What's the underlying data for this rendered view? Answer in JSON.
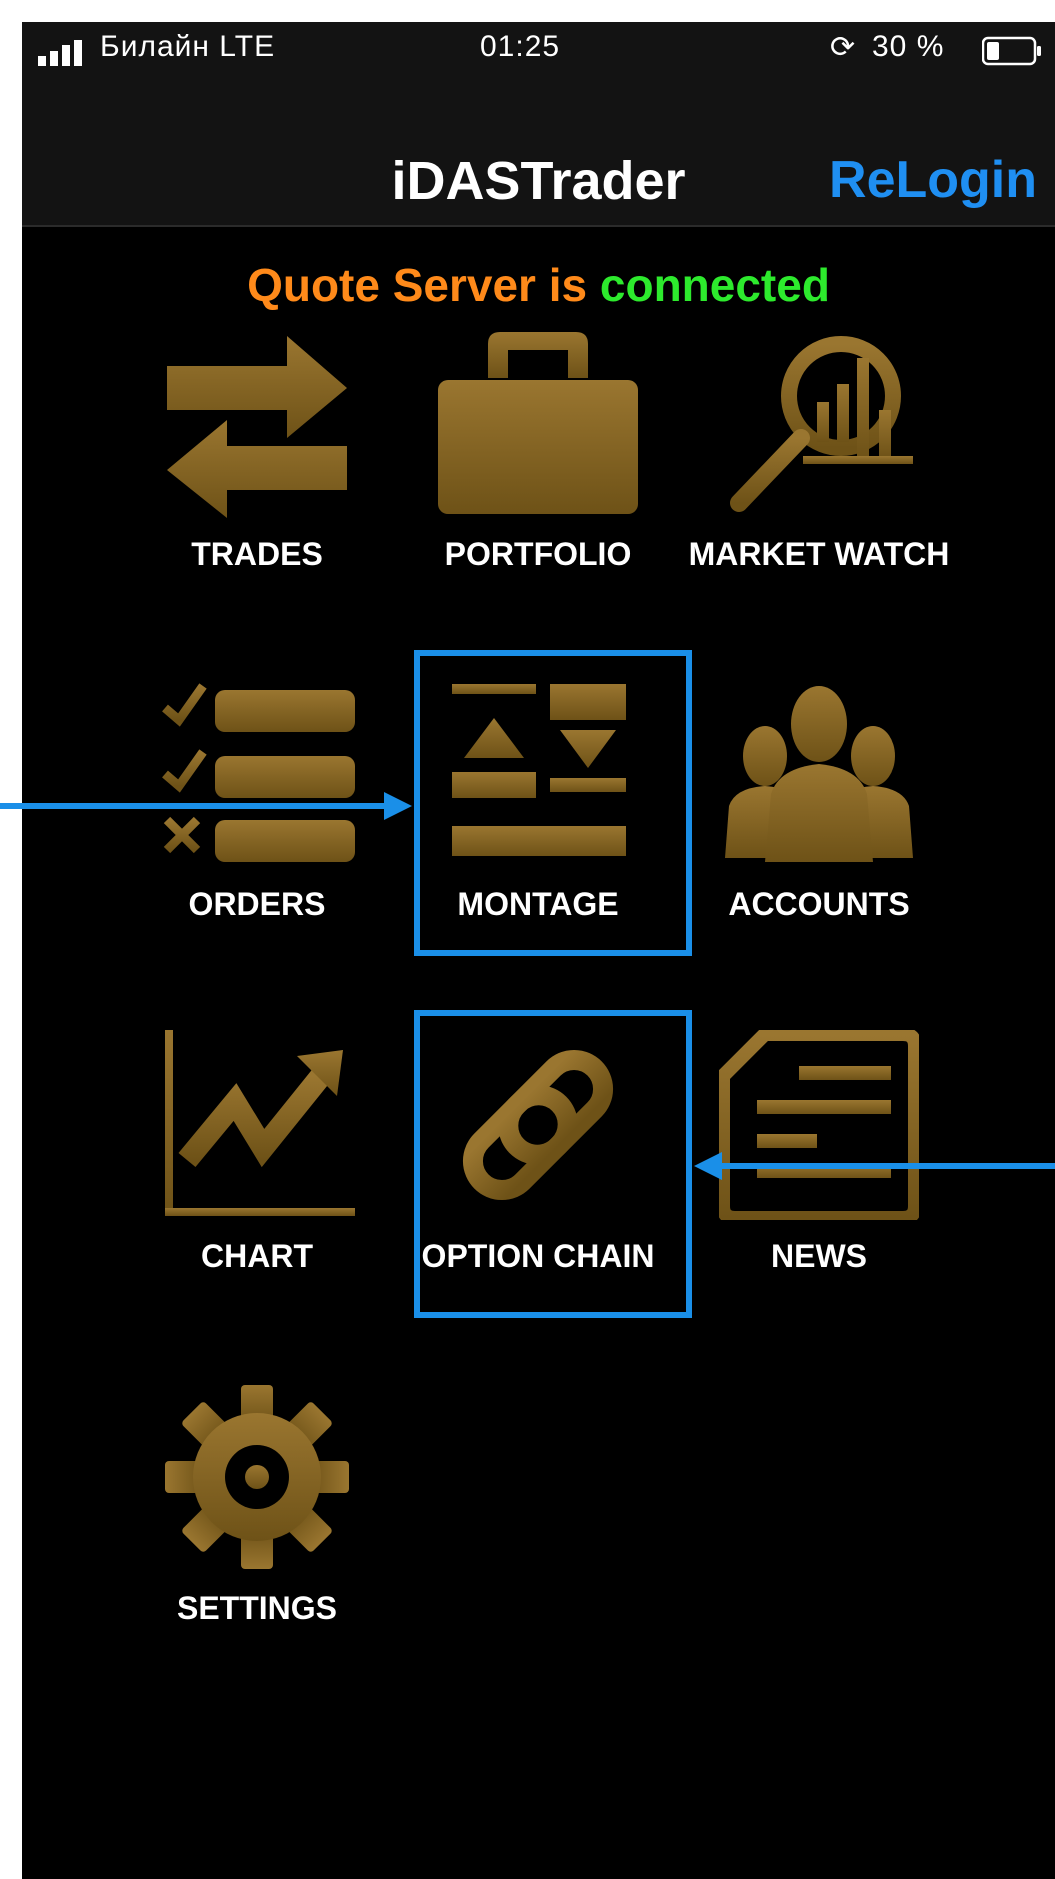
{
  "status_bar": {
    "carrier": "Билайн LTE",
    "time": "01:25",
    "battery": "30 %"
  },
  "nav": {
    "title": "iDASTrader",
    "relogin_label": "ReLogin"
  },
  "connection": {
    "prefix": "Quote Server is",
    "state": "connected"
  },
  "menu": {
    "trades": "TRADES",
    "portfolio": "PORTFOLIO",
    "market_watch": "MARKET WATCH",
    "orders": "ORDERS",
    "montage": "MONTAGE",
    "accounts": "ACCOUNTS",
    "chart": "CHART",
    "option_chain": "OPTION CHAIN",
    "news": "NEWS",
    "settings": "SETTINGS"
  },
  "colors": {
    "icon_gold": "#8b6a22",
    "highlight_blue": "#1a8fe8",
    "link_blue": "#1f8ff2",
    "status_orange": "#ff8a1a",
    "status_green": "#2dea2d"
  },
  "icons": [
    "arrows-swap-icon",
    "briefcase-icon",
    "magnifier-chart-icon",
    "checklist-icon",
    "montage-icon",
    "people-icon",
    "line-chart-icon",
    "chain-link-icon",
    "document-icon",
    "gear-icon"
  ]
}
